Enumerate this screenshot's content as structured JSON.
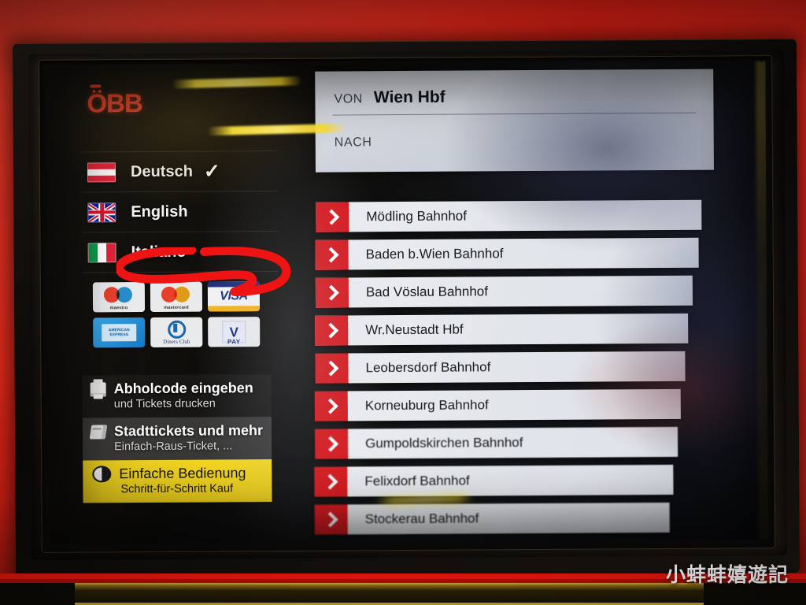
{
  "device": {
    "brand_logo": "ÖBB",
    "body_color": "#e8180f",
    "accent_red": "#d5181d",
    "accent_yellow": "#f2d522"
  },
  "sidebar": {
    "languages": [
      {
        "label": "Deutsch",
        "flag": "flag-austria-icon",
        "selected": true,
        "check": "✓"
      },
      {
        "label": "English",
        "flag": "flag-uk-icon",
        "selected": false,
        "check": ""
      },
      {
        "label": "Italiano",
        "flag": "flag-italy-icon",
        "selected": false,
        "check": ""
      }
    ],
    "payment_cards": [
      {
        "name": "maestro",
        "label": "maestro"
      },
      {
        "name": "mastercard",
        "label": "mastercard"
      },
      {
        "name": "visa",
        "label": "VISA"
      },
      {
        "name": "american-express",
        "label": "AMERICAN EXPRESS"
      },
      {
        "name": "diners-club",
        "label": "Diners Club"
      },
      {
        "name": "v-pay",
        "label": "V PAY"
      }
    ],
    "menu": [
      {
        "icon": "printer-icon",
        "title": "Abholcode eingeben",
        "subtitle": "und Tickets drucken"
      },
      {
        "icon": "ticket-icon",
        "title": "Stadttickets und mehr",
        "subtitle": "Einfach-Raus-Ticket, ..."
      },
      {
        "icon": "contrast-icon",
        "title": "Einfache Bedienung",
        "subtitle": "Schritt-für-Schritt Kauf"
      }
    ]
  },
  "search": {
    "from_label": "VON",
    "from_value": "Wien Hbf",
    "to_label": "NACH",
    "to_value": ""
  },
  "stations": [
    {
      "name": "Mödling Bahnhof"
    },
    {
      "name": "Baden b.Wien Bahnhof"
    },
    {
      "name": "Bad Vöslau Bahnhof"
    },
    {
      "name": "Wr.Neustadt Hbf"
    },
    {
      "name": "Leobersdorf Bahnhof"
    },
    {
      "name": "Korneuburg Bahnhof"
    },
    {
      "name": "Gumpoldskirchen Bahnhof"
    },
    {
      "name": "Felixdorf Bahnhof"
    },
    {
      "name": "Stockerau Bahnhof"
    }
  ],
  "annotation": {
    "shape": "hand-drawn-red-ellipse",
    "target": "English",
    "color": "#ef1414"
  },
  "watermark": {
    "text": "小蚌蚌嬉遊記"
  }
}
